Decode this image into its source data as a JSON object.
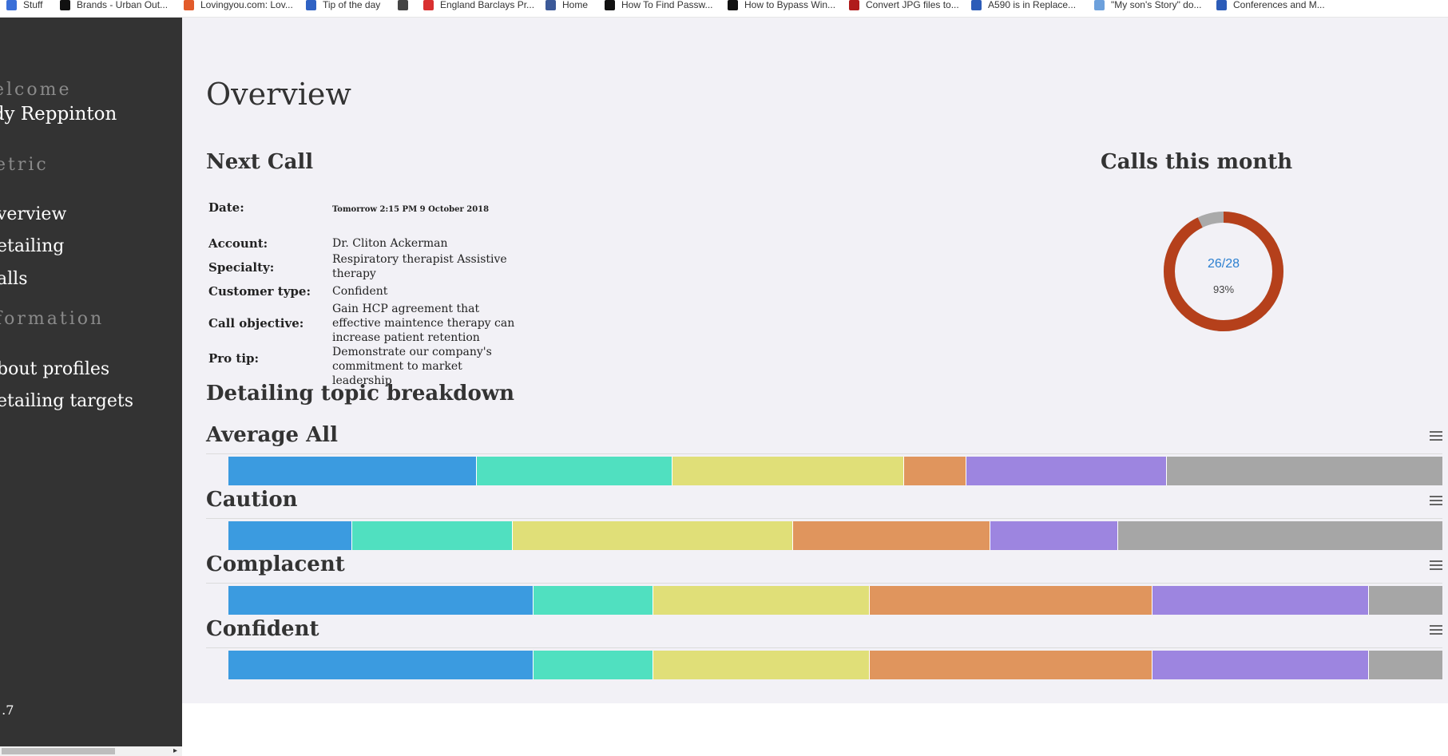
{
  "bookmarks": [
    {
      "label": "Stuff",
      "icon": "pencil-icon",
      "color": "#3a6fd8"
    },
    {
      "label": "Brands - Urban Out...",
      "icon": "uo-logo-icon",
      "color": "#111111"
    },
    {
      "label": "Lovingyou.com: Lov...",
      "icon": "flower-icon",
      "color": "#e25b2a"
    },
    {
      "label": "Tip of the day",
      "icon": "vs-logo-icon",
      "color": "#2f62c4"
    },
    {
      "label": "",
      "icon": "globe-icon",
      "color": "#444444"
    },
    {
      "label": "England Barclays Pr...",
      "icon": "swoosh-icon",
      "color": "#d93030"
    },
    {
      "label": "Home",
      "icon": "facebook-icon",
      "color": "#3b5998"
    },
    {
      "label": "How To Find Passw...",
      "icon": "tn-logo-icon",
      "color": "#111111"
    },
    {
      "label": "How to Bypass Win...",
      "icon": "tn-logo-icon",
      "color": "#111111"
    },
    {
      "label": "Convert JPG files to...",
      "icon": "pdf-icon",
      "color": "#b01c1c"
    },
    {
      "label": "A590 is in Replace...",
      "icon": "flag-icon",
      "color": "#2c5cb8"
    },
    {
      "label": "\"My son's Story\" do...",
      "icon": "bf-logo-icon",
      "color": "#6ca0dc"
    },
    {
      "label": "Conferences and M...",
      "icon": "arrow-logo-icon",
      "color": "#2c5cb8"
    }
  ],
  "sidebar": {
    "greeting": "elcome",
    "user": "ndy Reppinton",
    "section_metric": "etric",
    "link_overview": "verview",
    "link_detailing": "etailing",
    "link_calls": "alls",
    "section_information": "formation",
    "link_profiles": "bout profiles",
    "link_targets": "etailing targets",
    "version": "1.7"
  },
  "main": {
    "title": "Overview",
    "next_call": {
      "heading": "Next Call",
      "date_label": "Date:",
      "date_value": "Tomorrow 2:15 PM 9 October 2018",
      "account_label": "Account:",
      "account_value": "Dr. Cliton Ackerman",
      "specialty_label": "Specialty:",
      "specialty_value": "Respiratory therapist Assistive therapy",
      "customer_type_label": "Customer type:",
      "customer_type_value": "Confident",
      "objective_label": "Call objective:",
      "objective_value": "Gain HCP agreement that effective maintence therapy can increase patient retention",
      "protip_label": "Pro tip:",
      "protip_value": "Demonstrate our company's commitment to market leadership"
    },
    "calls_month": {
      "heading": "Calls this month",
      "count_text": "26/28",
      "percent_text": "93%",
      "done": 26,
      "total": 28,
      "done_color": "#b5401b",
      "remaining_color": "#aaaaaa"
    },
    "breakdown_heading": "Detailing topic breakdown"
  },
  "chart_data": {
    "type": "bar",
    "stacked": true,
    "orientation": "horizontal",
    "colors": [
      "#3b9be0",
      "#50e0c0",
      "#e0df78",
      "#e0955d",
      "#9d85e0",
      "#a6a6a6"
    ],
    "rows": [
      {
        "name": "Average All",
        "values": [
          17.7,
          13.9,
          16.5,
          4.4,
          14.3,
          19.6
        ]
      },
      {
        "name": "Caution",
        "values": [
          8.8,
          11.4,
          19.9,
          14.0,
          9.1,
          23.0
        ]
      },
      {
        "name": "Complacent",
        "values": [
          21.7,
          8.5,
          15.4,
          20.1,
          15.4,
          5.2
        ]
      },
      {
        "name": "Confident",
        "values": [
          21.7,
          8.5,
          15.4,
          20.1,
          15.4,
          5.2
        ]
      }
    ]
  }
}
